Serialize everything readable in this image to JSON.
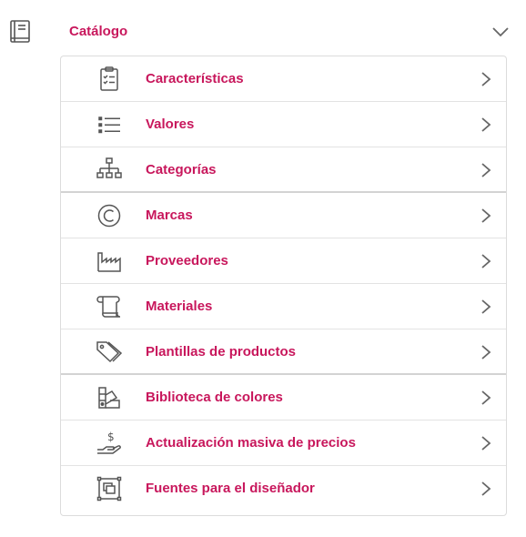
{
  "section": {
    "title": "Catálogo",
    "icon": "book-icon",
    "expanded": true
  },
  "colors": {
    "accent": "#c8175c",
    "icon": "#555555",
    "border": "#dcdcdc"
  },
  "items": [
    {
      "label": "Características",
      "icon": "clipboard-checklist-icon"
    },
    {
      "label": "Valores",
      "icon": "list-icon"
    },
    {
      "label": "Categorías",
      "icon": "sitemap-icon"
    },
    {
      "label": "Marcas",
      "icon": "copyright-icon"
    },
    {
      "label": "Proveedores",
      "icon": "factory-icon"
    },
    {
      "label": "Materiales",
      "icon": "scroll-icon"
    },
    {
      "label": "Plantillas de productos",
      "icon": "tags-icon"
    },
    {
      "label": "Biblioteca de colores",
      "icon": "swatches-icon"
    },
    {
      "label": "Actualización masiva de precios",
      "icon": "hand-dollar-icon"
    },
    {
      "label": "Fuentes para el diseñador",
      "icon": "layers-frame-icon"
    }
  ]
}
